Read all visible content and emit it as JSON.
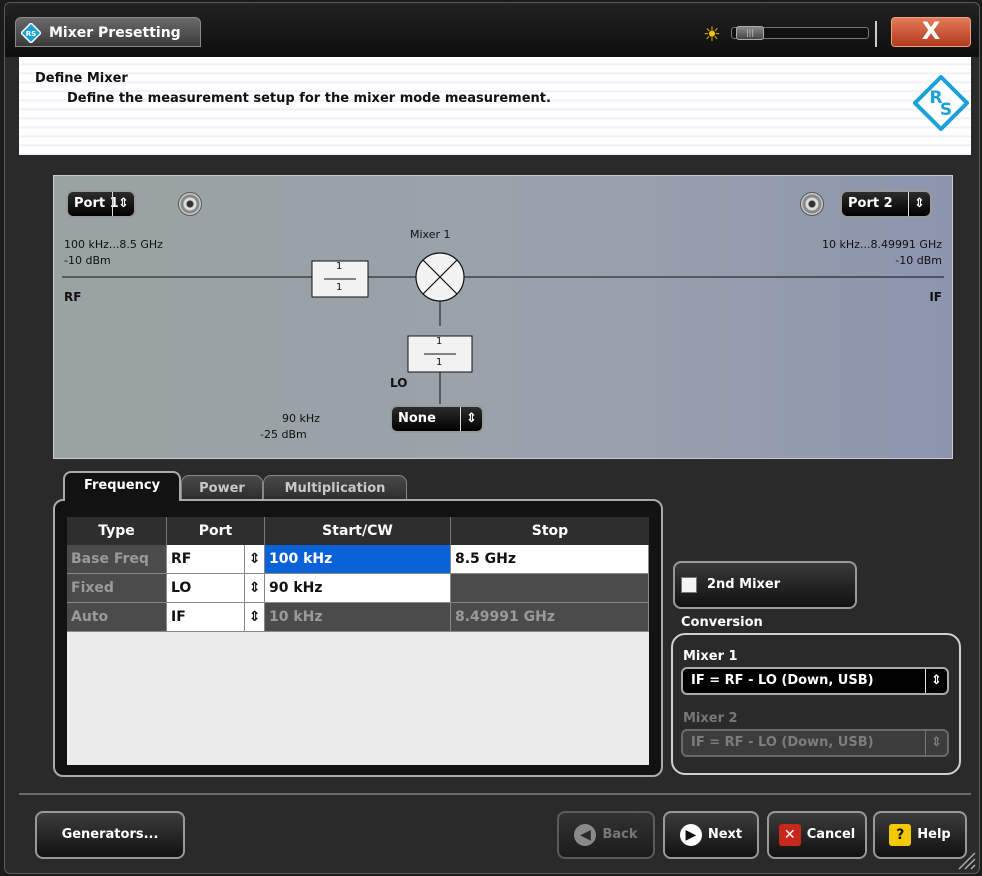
{
  "window": {
    "title": "Mixer Presetting",
    "close_label": "X"
  },
  "header": {
    "title": "Define Mixer",
    "description": "Define the measurement setup for the mixer mode measurement."
  },
  "diagram": {
    "port1": "Port 1",
    "port2": "Port 2",
    "mixer_label": "Mixer 1",
    "rf_range": "100 kHz...8.5 GHz",
    "rf_power": "-10 dBm",
    "rf_label": "RF",
    "if_range": "10 kHz...8.49991 GHz",
    "if_power": "-10 dBm",
    "if_label": "IF",
    "lo_label": "LO",
    "lo_freq": "90 kHz",
    "lo_power": "-25 dBm",
    "lo_source": "None",
    "multiplier_num": "1",
    "multiplier_den": "1"
  },
  "tabs": [
    {
      "label": "Frequency",
      "active": true
    },
    {
      "label": "Power",
      "active": false
    },
    {
      "label": "Multiplication",
      "active": false
    }
  ],
  "table": {
    "headers": [
      "Type",
      "Port",
      "Start/CW",
      "Stop"
    ],
    "rows": [
      {
        "type": "Base Freq",
        "port": "RF",
        "start": "100 kHz",
        "stop": "8.5 GHz"
      },
      {
        "type": "Fixed",
        "port": "LO",
        "start": "90 kHz",
        "stop": ""
      },
      {
        "type": "Auto",
        "port": "IF",
        "start": "10 kHz",
        "stop": "8.49991 GHz"
      }
    ]
  },
  "second_mixer": {
    "label": "2nd Mixer",
    "checked": false
  },
  "conversion": {
    "title": "Conversion",
    "mixer1_label": "Mixer 1",
    "mixer1_value": "IF = RF - LO (Down, USB)",
    "mixer2_label": "Mixer 2",
    "mixer2_value": "IF = RF - LO (Down, USB)"
  },
  "buttons": {
    "generators": "Generators...",
    "back": "Back",
    "next": "Next",
    "cancel": "Cancel",
    "help": "Help"
  },
  "colors": {
    "accent": "#0a62d8",
    "brand": "#1ca0d8",
    "cancel_red": "#c8281c"
  }
}
